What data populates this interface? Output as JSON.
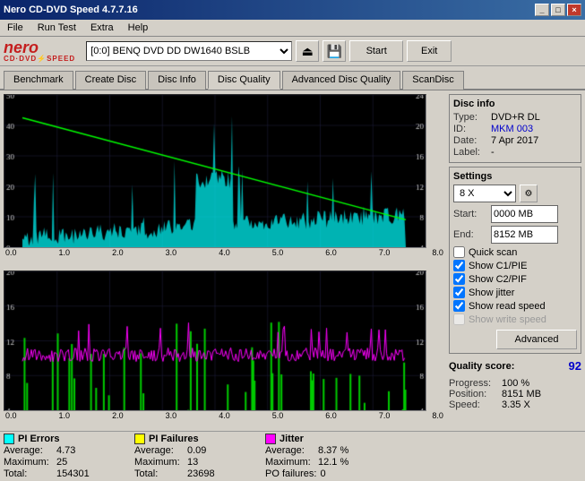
{
  "titleBar": {
    "title": "Nero CD-DVD Speed 4.7.7.16",
    "buttons": [
      "_",
      "□",
      "×"
    ]
  },
  "menuBar": {
    "items": [
      "File",
      "Run Test",
      "Extra",
      "Help"
    ]
  },
  "toolbar": {
    "driveLabel": "[0:0]  BENQ DVD DD DW1640 BSLB",
    "startBtn": "Start",
    "exitBtn": "Exit"
  },
  "tabs": {
    "items": [
      "Benchmark",
      "Create Disc",
      "Disc Info",
      "Disc Quality",
      "Advanced Disc Quality",
      "ScanDisc"
    ],
    "activeIndex": 3
  },
  "discInfo": {
    "title": "Disc info",
    "type": {
      "label": "Type:",
      "value": "DVD+R DL"
    },
    "id": {
      "label": "ID:",
      "value": "MKM 003"
    },
    "date": {
      "label": "Date:",
      "value": "7 Apr 2017"
    },
    "label": {
      "label": "Label:",
      "value": "-"
    }
  },
  "settings": {
    "title": "Settings",
    "speed": "8 X",
    "start": {
      "label": "Start:",
      "value": "0000 MB"
    },
    "end": {
      "label": "End:",
      "value": "8152 MB"
    },
    "checkboxes": {
      "quickScan": {
        "label": "Quick scan",
        "checked": false
      },
      "showC1PIE": {
        "label": "Show C1/PIE",
        "checked": true
      },
      "showC2PIF": {
        "label": "Show C2/PIF",
        "checked": true
      },
      "showJitter": {
        "label": "Show jitter",
        "checked": true
      },
      "showReadSpeed": {
        "label": "Show read speed",
        "checked": true
      },
      "showWriteSpeed": {
        "label": "Show write speed",
        "checked": false
      }
    },
    "advancedBtn": "Advanced"
  },
  "qualityScore": {
    "label": "Quality score:",
    "value": "92"
  },
  "stats": {
    "piErrors": {
      "label": "PI Errors",
      "color": "#00ffff",
      "average": {
        "label": "Average:",
        "value": "4.73"
      },
      "maximum": {
        "label": "Maximum:",
        "value": "25"
      },
      "total": {
        "label": "Total:",
        "value": "154301"
      }
    },
    "piFailures": {
      "label": "PI Failures",
      "color": "#ffff00",
      "average": {
        "label": "Average:",
        "value": "0.09"
      },
      "maximum": {
        "label": "Maximum:",
        "value": "13"
      },
      "total": {
        "label": "Total:",
        "value": "23698"
      }
    },
    "jitter": {
      "label": "Jitter",
      "color": "#ff00ff",
      "average": {
        "label": "Average:",
        "value": "8.37 %"
      },
      "maximum": {
        "label": "Maximum:",
        "value": "12.1 %"
      },
      "poFailures": {
        "label": "PO failures:",
        "value": "0"
      }
    }
  },
  "progress": {
    "progress": {
      "label": "Progress:",
      "value": "100 %"
    },
    "position": {
      "label": "Position:",
      "value": "8151 MB"
    },
    "speed": {
      "label": "Speed:",
      "value": "3.35 X"
    }
  },
  "charts": {
    "top": {
      "yLeftLabels": [
        "50",
        "40",
        "30",
        "20",
        "10",
        "0"
      ],
      "yRightLabels": [
        "24",
        "20",
        "16",
        "12",
        "8",
        "4"
      ],
      "xLabels": [
        "0.0",
        "1.0",
        "2.0",
        "3.0",
        "4.0",
        "5.0",
        "6.0",
        "7.0",
        "8.0"
      ]
    },
    "bottom": {
      "yLeftLabels": [
        "20",
        "16",
        "12",
        "8",
        "4"
      ],
      "yRightLabels": [
        "20",
        "16",
        "12",
        "8",
        "4"
      ],
      "xLabels": [
        "0.0",
        "1.0",
        "2.0",
        "3.0",
        "4.0",
        "5.0",
        "6.0",
        "7.0",
        "8.0"
      ]
    }
  }
}
